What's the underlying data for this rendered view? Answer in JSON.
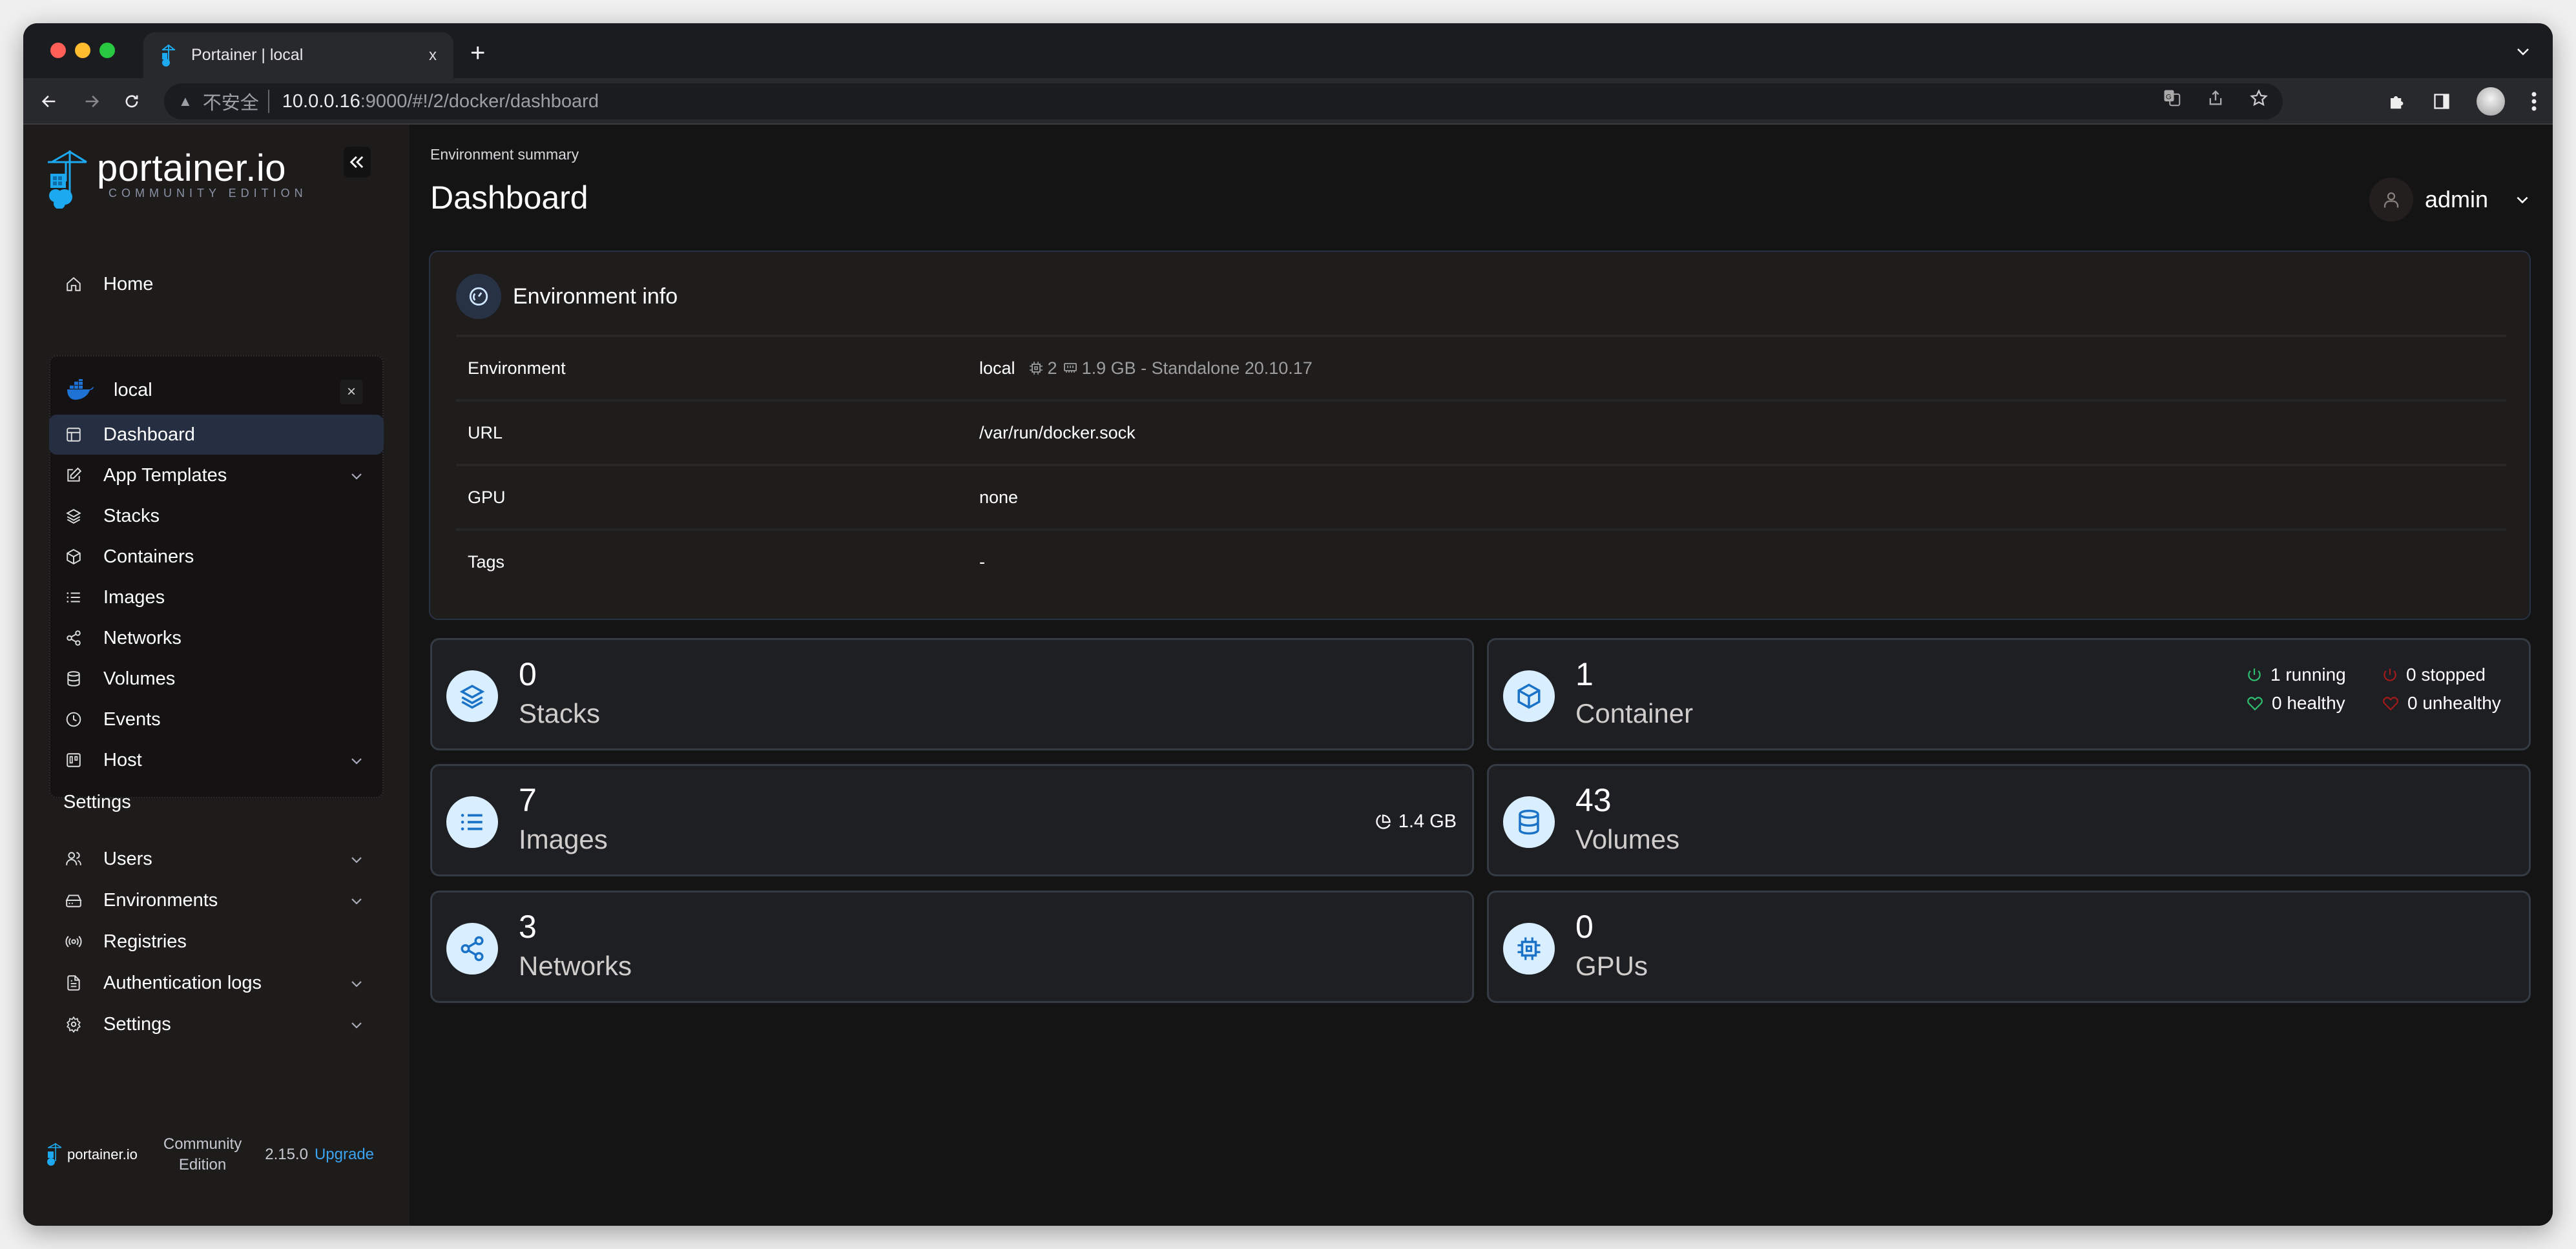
{
  "browser": {
    "tab_title": "Portainer | local",
    "new_tab": "+",
    "tab_close": "x",
    "insecure_label": "不安全",
    "url_host": "10.0.0.16",
    "url_rest": ":9000/#!/2/docker/dashboard",
    "traffic_colors": [
      "#ff5f57",
      "#febc2e",
      "#28c840"
    ]
  },
  "sidebar": {
    "logo_text": "portainer.io",
    "logo_subtitle": "COMMUNITY EDITION",
    "home": "Home",
    "environment": {
      "name": "local",
      "close": "×",
      "items": [
        {
          "label": "Dashboard",
          "icon": "dashboard-icon",
          "active": true
        },
        {
          "label": "App Templates",
          "icon": "edit-icon",
          "expandable": true
        },
        {
          "label": "Stacks",
          "icon": "layers-icon"
        },
        {
          "label": "Containers",
          "icon": "box-icon"
        },
        {
          "label": "Images",
          "icon": "list-icon"
        },
        {
          "label": "Networks",
          "icon": "share-icon"
        },
        {
          "label": "Volumes",
          "icon": "database-icon"
        },
        {
          "label": "Events",
          "icon": "clock-icon"
        },
        {
          "label": "Host",
          "icon": "trello-icon",
          "expandable": true
        }
      ]
    },
    "settings_heading": "Settings",
    "settings_items": [
      {
        "label": "Users",
        "icon": "users-icon",
        "expandable": true
      },
      {
        "label": "Environments",
        "icon": "hard-drive-icon",
        "expandable": true
      },
      {
        "label": "Registries",
        "icon": "radio-icon"
      },
      {
        "label": "Authentication logs",
        "icon": "file-text-icon",
        "expandable": true
      },
      {
        "label": "Settings",
        "icon": "gear-icon",
        "expandable": true
      }
    ],
    "footer": {
      "logo_text": "portainer.io",
      "edition_line1": "Community",
      "edition_line2": "Edition",
      "version": "2.15.0",
      "upgrade": "Upgrade"
    }
  },
  "header": {
    "breadcrumb": "Environment summary",
    "title": "Dashboard",
    "user": "admin"
  },
  "env_info": {
    "title": "Environment info",
    "rows": [
      {
        "key": "Environment",
        "value": "local",
        "cpu": "2",
        "memory": "1.9 GB - Standalone 20.10.17"
      },
      {
        "key": "URL",
        "value": "/var/run/docker.sock"
      },
      {
        "key": "GPU",
        "value": "none"
      },
      {
        "key": "Tags",
        "value": "-"
      }
    ]
  },
  "cards": {
    "stacks": {
      "count": "0",
      "label": "Stacks"
    },
    "containers": {
      "count": "1",
      "label": "Container",
      "running": "1 running",
      "stopped": "0 stopped",
      "healthy": "0 healthy",
      "unhealthy": "0 unhealthy"
    },
    "images": {
      "count": "7",
      "label": "Images",
      "size": "1.4 GB"
    },
    "volumes": {
      "count": "43",
      "label": "Volumes"
    },
    "networks": {
      "count": "3",
      "label": "Networks"
    },
    "gpus": {
      "count": "0",
      "label": "GPUs"
    }
  },
  "colors": {
    "accent": "#3ba3f0",
    "icon_blue": "#1a73c7",
    "icon_bg": "#d9eeff",
    "status_green": "#2fbf71",
    "status_red": "#a31a1a",
    "active_nav": "#262f42"
  }
}
